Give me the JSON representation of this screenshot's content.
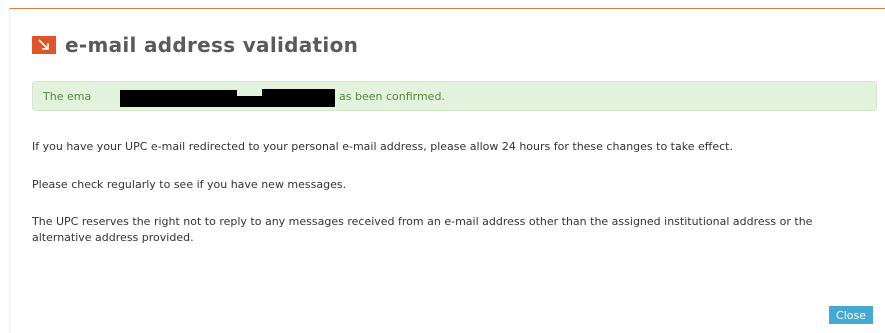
{
  "dialog": {
    "title": "e-mail address validation",
    "title_icon": "arrow-down-right-icon",
    "accent_color": "#e0542a",
    "alert": {
      "text_start": "The ema",
      "text_end": "as been confirmed.",
      "color": "#4f8a3b",
      "background": "#e3f2dc"
    },
    "paragraphs": [
      "If you have your UPC e-mail redirected to your personal e-mail address, please allow 24 hours for these changes to take effect.",
      "Please check regularly to see if you have new messages.",
      "The UPC reserves the right not to reply to any messages received from an e-mail address other than the assigned institutional address or the alternative address provided."
    ],
    "close_label": "Close",
    "close_color": "#45a9d3"
  }
}
